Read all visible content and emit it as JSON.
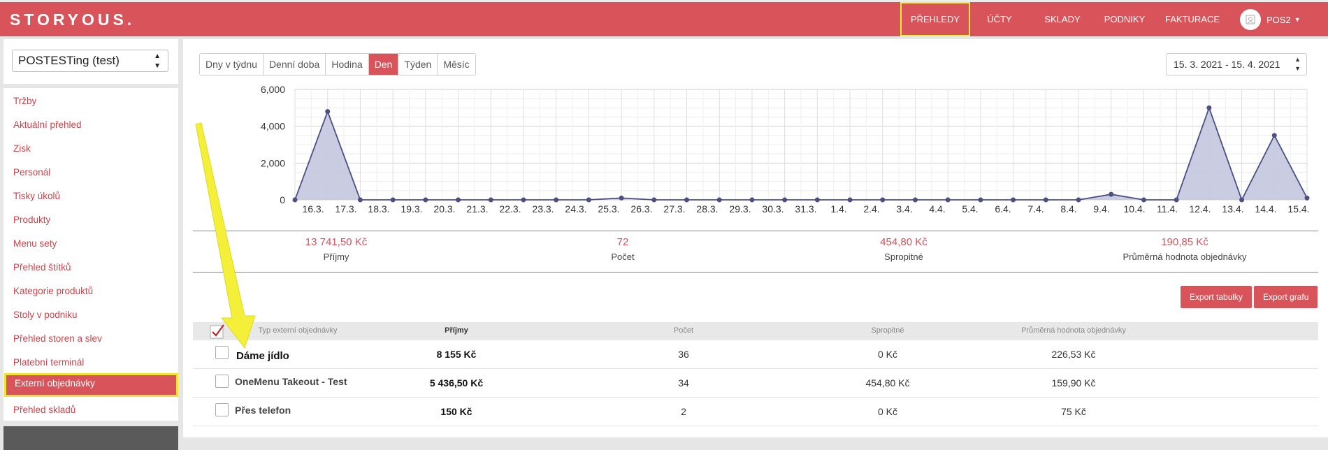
{
  "topbar": {
    "logo": "STORYOUS.",
    "nav": [
      "PŘEHLEDY",
      "ÚČTY",
      "SKLADY",
      "PODNIKY",
      "FAKTURACE"
    ],
    "user": "POS2",
    "highlight_color": "#f6ec3a",
    "brand_color": "#d9535a"
  },
  "sidebar": {
    "venue_select": "POSTESTing (test)",
    "items": [
      "Tržby",
      "Aktuální přehled",
      "Zisk",
      "Personál",
      "Tisky úkolů",
      "Produkty",
      "Menu sety",
      "Přehled štítků",
      "Kategorie produktů",
      "Stoly v podniku",
      "Přehled storen a slev",
      "Platební terminál",
      "Externí objednávky",
      "Přehled skladů"
    ],
    "active_item": "Externí objednávky"
  },
  "toolbar": {
    "segments": [
      "Dny v týdnu",
      "Denní doba",
      "Hodina",
      "Den",
      "Týden",
      "Měsíc"
    ],
    "active_segment": "Den",
    "date_range": "15. 3. 2021 - 15. 4. 2021"
  },
  "chart_data": {
    "type": "area",
    "x": [
      "16.3.",
      "17.3.",
      "18.3.",
      "19.3.",
      "20.3.",
      "21.3.",
      "22.3.",
      "23.3.",
      "24.3.",
      "25.3.",
      "26.3.",
      "27.3.",
      "28.3.",
      "29.3.",
      "30.3.",
      "31.3.",
      "1.4.",
      "2.4.",
      "3.4.",
      "4.4.",
      "5.4.",
      "6.4.",
      "7.4.",
      "8.4.",
      "9.4.",
      "10.4.",
      "11.4.",
      "12.4.",
      "13.4.",
      "14.4.",
      "15.4."
    ],
    "values": [
      0,
      4800,
      0,
      0,
      0,
      0,
      0,
      0,
      0,
      0,
      100,
      0,
      0,
      0,
      0,
      0,
      0,
      0,
      0,
      0,
      0,
      0,
      0,
      0,
      0,
      300,
      0,
      0,
      5000,
      0,
      3500,
      100
    ],
    "y_ticks": [
      "0",
      "2,000",
      "4,000",
      "6,000"
    ],
    "ylim": [
      0,
      6000
    ],
    "grid": true,
    "line_color": "#4a4f84",
    "fill_color": "#c4c7df"
  },
  "summary": [
    {
      "value": "13 741,50 Kč",
      "label": "Příjmy"
    },
    {
      "value": "72",
      "label": "Počet"
    },
    {
      "value": "454,80 Kč",
      "label": "Spropitné"
    },
    {
      "value": "190,85 Kč",
      "label": "Průměrná hodnota objednávky"
    }
  ],
  "buttons": {
    "export_table": "Export tabulky",
    "export_chart": "Export grafu"
  },
  "table": {
    "headers": [
      "Typ externí objednávky",
      "Příjmy",
      "Počet",
      "Spropitné",
      "Průměrná hodnota objednávky"
    ],
    "rows": [
      [
        "Dáme jídlo",
        "8 155 Kč",
        "36",
        "0 Kč",
        "226,53 Kč"
      ],
      [
        "OneMenu Takeout - Test",
        "5 436,50 Kč",
        "34",
        "454,80 Kč",
        "159,90 Kč"
      ],
      [
        "Přes telefon",
        "150 Kč",
        "2",
        "0 Kč",
        "75 Kč"
      ]
    ]
  },
  "annotation": {
    "arrow_color": "#f4ef38"
  }
}
